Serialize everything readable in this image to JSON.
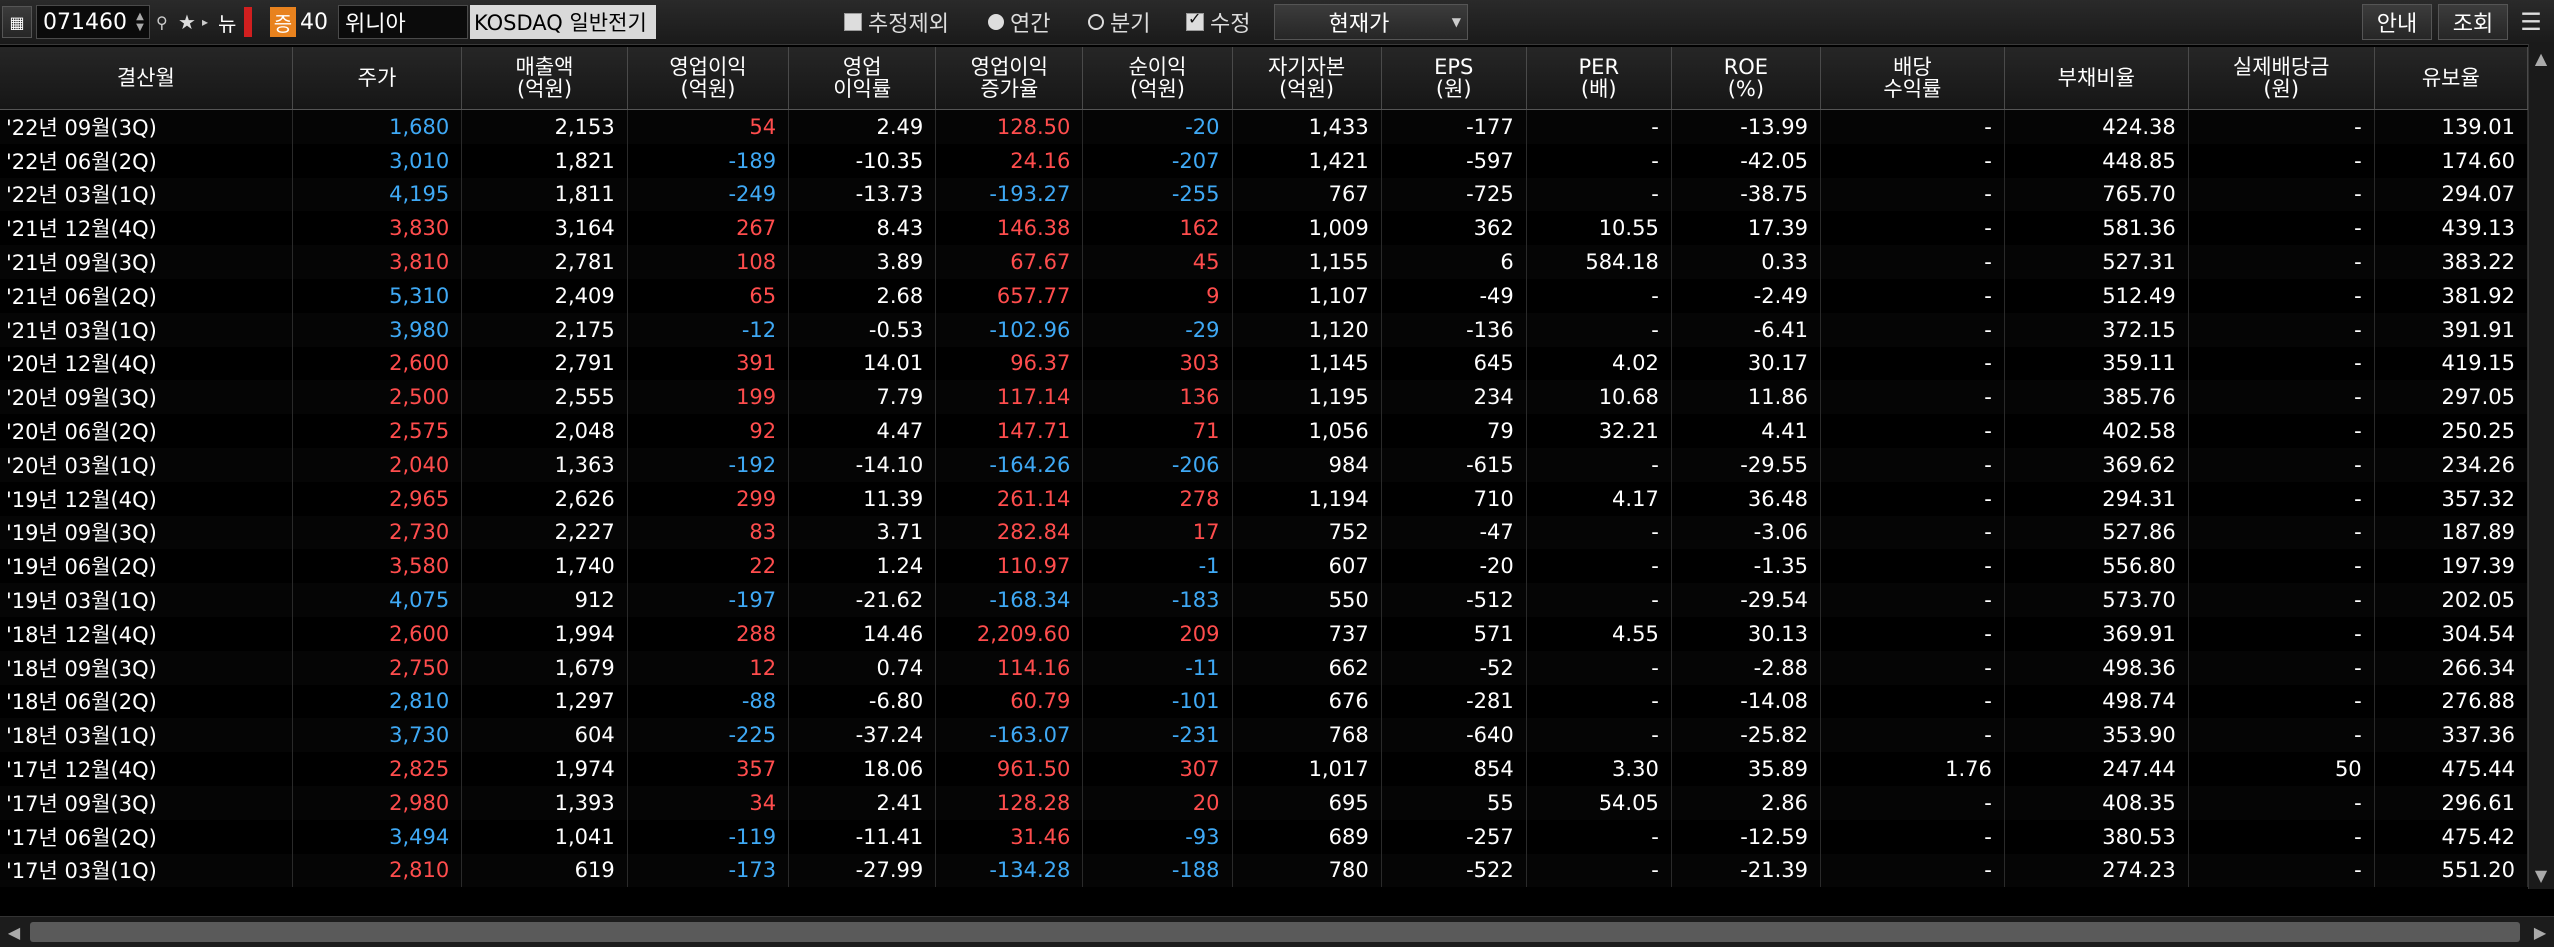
{
  "toolbar": {
    "code_value": "071460",
    "market_badge": "뉴",
    "rating_badge": "증",
    "rating_value": "40",
    "company_name": "위니아",
    "market_type": "KOSDAQ 일반전기",
    "options": {
      "exclude_estimate": "추정제외",
      "annual": "연간",
      "quarterly": "분기",
      "revised": "수정"
    },
    "price_select": "현재가",
    "guide_button": "안내",
    "query_button": "조회",
    "colors": {
      "up": "#ff4d4d",
      "down": "#3fa9f5",
      "neutral": "#ffffff",
      "badge_orange": "#e8821e"
    }
  },
  "table": {
    "headers": [
      "결산월",
      "주가",
      "매출액\n(억원)",
      "영업이익\n(억원)",
      "영업\n이익률",
      "영업이익\n증가율",
      "순이익\n(억원)",
      "자기자본\n(억원)",
      "EPS\n(원)",
      "PER\n(배)",
      "ROE\n(%)",
      "배당\n수익률",
      "부채비율",
      "실제배당금\n(원)",
      "유보율"
    ],
    "rows": [
      [
        "'22년 09월(3Q)",
        "1,680",
        "2,153",
        "54",
        "2.49",
        "128.50",
        "-20",
        "1,433",
        "-177",
        "-",
        "-13.99",
        "-",
        "424.38",
        "-",
        "139.01"
      ],
      [
        "'22년 06월(2Q)",
        "3,010",
        "1,821",
        "-189",
        "-10.35",
        "24.16",
        "-207",
        "1,421",
        "-597",
        "-",
        "-42.05",
        "-",
        "448.85",
        "-",
        "174.60"
      ],
      [
        "'22년 03월(1Q)",
        "4,195",
        "1,811",
        "-249",
        "-13.73",
        "-193.27",
        "-255",
        "767",
        "-725",
        "-",
        "-38.75",
        "-",
        "765.70",
        "-",
        "294.07"
      ],
      [
        "'21년 12월(4Q)",
        "3,830",
        "3,164",
        "267",
        "8.43",
        "146.38",
        "162",
        "1,009",
        "362",
        "10.55",
        "17.39",
        "-",
        "581.36",
        "-",
        "439.13"
      ],
      [
        "'21년 09월(3Q)",
        "3,810",
        "2,781",
        "108",
        "3.89",
        "67.67",
        "45",
        "1,155",
        "6",
        "584.18",
        "0.33",
        "-",
        "527.31",
        "-",
        "383.22"
      ],
      [
        "'21년 06월(2Q)",
        "5,310",
        "2,409",
        "65",
        "2.68",
        "657.77",
        "9",
        "1,107",
        "-49",
        "-",
        "-2.49",
        "-",
        "512.49",
        "-",
        "381.92"
      ],
      [
        "'21년 03월(1Q)",
        "3,980",
        "2,175",
        "-12",
        "-0.53",
        "-102.96",
        "-29",
        "1,120",
        "-136",
        "-",
        "-6.41",
        "-",
        "372.15",
        "-",
        "391.91"
      ],
      [
        "'20년 12월(4Q)",
        "2,600",
        "2,791",
        "391",
        "14.01",
        "96.37",
        "303",
        "1,145",
        "645",
        "4.02",
        "30.17",
        "-",
        "359.11",
        "-",
        "419.15"
      ],
      [
        "'20년 09월(3Q)",
        "2,500",
        "2,555",
        "199",
        "7.79",
        "117.14",
        "136",
        "1,195",
        "234",
        "10.68",
        "11.86",
        "-",
        "385.76",
        "-",
        "297.05"
      ],
      [
        "'20년 06월(2Q)",
        "2,575",
        "2,048",
        "92",
        "4.47",
        "147.71",
        "71",
        "1,056",
        "79",
        "32.21",
        "4.41",
        "-",
        "402.58",
        "-",
        "250.25"
      ],
      [
        "'20년 03월(1Q)",
        "2,040",
        "1,363",
        "-192",
        "-14.10",
        "-164.26",
        "-206",
        "984",
        "-615",
        "-",
        "-29.55",
        "-",
        "369.62",
        "-",
        "234.26"
      ],
      [
        "'19년 12월(4Q)",
        "2,965",
        "2,626",
        "299",
        "11.39",
        "261.14",
        "278",
        "1,194",
        "710",
        "4.17",
        "36.48",
        "-",
        "294.31",
        "-",
        "357.32"
      ],
      [
        "'19년 09월(3Q)",
        "2,730",
        "2,227",
        "83",
        "3.71",
        "282.84",
        "17",
        "752",
        "-47",
        "-",
        "-3.06",
        "-",
        "527.86",
        "-",
        "187.89"
      ],
      [
        "'19년 06월(2Q)",
        "3,580",
        "1,740",
        "22",
        "1.24",
        "110.97",
        "-1",
        "607",
        "-20",
        "-",
        "-1.35",
        "-",
        "556.80",
        "-",
        "197.39"
      ],
      [
        "'19년 03월(1Q)",
        "4,075",
        "912",
        "-197",
        "-21.62",
        "-168.34",
        "-183",
        "550",
        "-512",
        "-",
        "-29.54",
        "-",
        "573.70",
        "-",
        "202.05"
      ],
      [
        "'18년 12월(4Q)",
        "2,600",
        "1,994",
        "288",
        "14.46",
        "2,209.60",
        "209",
        "737",
        "571",
        "4.55",
        "30.13",
        "-",
        "369.91",
        "-",
        "304.54"
      ],
      [
        "'18년 09월(3Q)",
        "2,750",
        "1,679",
        "12",
        "0.74",
        "114.16",
        "-11",
        "662",
        "-52",
        "-",
        "-2.88",
        "-",
        "498.36",
        "-",
        "266.34"
      ],
      [
        "'18년 06월(2Q)",
        "2,810",
        "1,297",
        "-88",
        "-6.80",
        "60.79",
        "-101",
        "676",
        "-281",
        "-",
        "-14.08",
        "-",
        "498.74",
        "-",
        "276.88"
      ],
      [
        "'18년 03월(1Q)",
        "3,730",
        "604",
        "-225",
        "-37.24",
        "-163.07",
        "-231",
        "768",
        "-640",
        "-",
        "-25.82",
        "-",
        "353.90",
        "-",
        "337.36"
      ],
      [
        "'17년 12월(4Q)",
        "2,825",
        "1,974",
        "357",
        "18.06",
        "961.50",
        "307",
        "1,017",
        "854",
        "3.30",
        "35.89",
        "1.76",
        "247.44",
        "50",
        "475.44"
      ],
      [
        "'17년 09월(3Q)",
        "2,980",
        "1,393",
        "34",
        "2.41",
        "128.28",
        "20",
        "695",
        "55",
        "54.05",
        "2.86",
        "-",
        "408.35",
        "-",
        "296.61"
      ],
      [
        "'17년 06월(2Q)",
        "3,494",
        "1,041",
        "-119",
        "-11.41",
        "31.46",
        "-93",
        "689",
        "-257",
        "-",
        "-12.59",
        "-",
        "380.53",
        "-",
        "475.42"
      ],
      [
        "'17년 03월(1Q)",
        "2,810",
        "619",
        "-173",
        "-27.99",
        "-134.28",
        "-188",
        "780",
        "-522",
        "-",
        "-21.39",
        "-",
        "274.23",
        "-",
        "551.20"
      ]
    ],
    "price_colors": [
      "down",
      "down",
      "down",
      "up",
      "up",
      "down",
      "down",
      "up",
      "up",
      "up",
      "up",
      "up",
      "up",
      "up",
      "down",
      "up",
      "up",
      "down",
      "down",
      "up",
      "up",
      "down",
      "up"
    ]
  }
}
